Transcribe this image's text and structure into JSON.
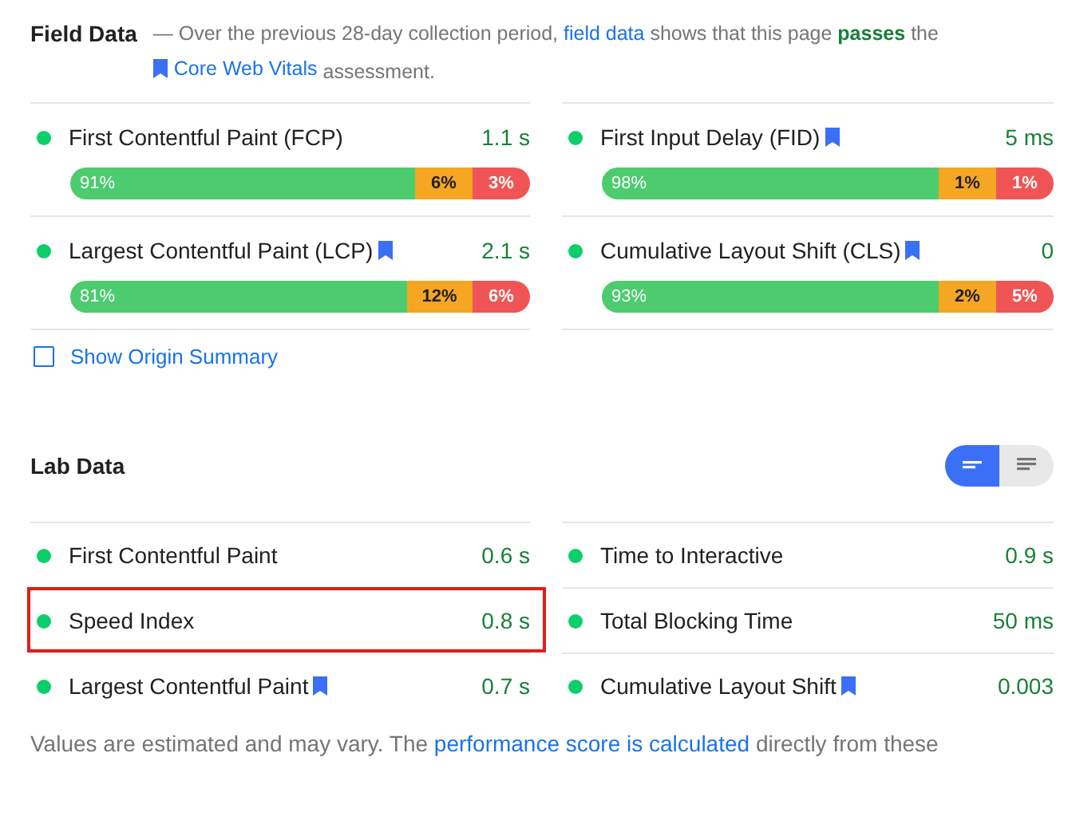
{
  "field_data": {
    "title": "Field Data",
    "description": [
      {
        "kind": "plain",
        "text": "— Over the previous 28-day collection period,"
      },
      {
        "kind": "link",
        "text": "field data"
      },
      {
        "kind": "plain",
        "text": "shows that this page"
      },
      {
        "kind": "pass",
        "text": "passes"
      },
      {
        "kind": "plain",
        "text": "the"
      },
      {
        "kind": "bookmark-link",
        "text": "Core Web Vitals"
      },
      {
        "kind": "plain",
        "text": "assessment."
      }
    ],
    "metrics": [
      {
        "name": "First Contentful Paint (FCP)",
        "bookmark": false,
        "value": "1.1 s",
        "distribution": [
          {
            "label": "91%",
            "kind": "good"
          },
          {
            "label": "6%",
            "kind": "average"
          },
          {
            "label": "3%",
            "kind": "poor"
          }
        ]
      },
      {
        "name": "First Input Delay (FID)",
        "bookmark": true,
        "value": "5 ms",
        "distribution": [
          {
            "label": "98%",
            "kind": "good"
          },
          {
            "label": "1%",
            "kind": "average"
          },
          {
            "label": "1%",
            "kind": "poor"
          }
        ]
      },
      {
        "name": "Largest Contentful Paint (LCP)",
        "bookmark": true,
        "value": "2.1 s",
        "distribution": [
          {
            "label": "81%",
            "kind": "good"
          },
          {
            "label": "12%",
            "kind": "average"
          },
          {
            "label": "6%",
            "kind": "poor"
          }
        ]
      },
      {
        "name": "Cumulative Layout Shift (CLS)",
        "bookmark": true,
        "value": "0",
        "distribution": [
          {
            "label": "93%",
            "kind": "good"
          },
          {
            "label": "2%",
            "kind": "average"
          },
          {
            "label": "5%",
            "kind": "poor"
          }
        ]
      }
    ],
    "origin_summary": {
      "label": "Show Origin Summary",
      "checked": false
    }
  },
  "lab_data": {
    "title": "Lab Data",
    "view_toggle": [
      {
        "kind": "compact",
        "selected": true
      },
      {
        "kind": "expanded",
        "selected": false
      }
    ],
    "metrics": [
      {
        "name": "First Contentful Paint",
        "bookmark": false,
        "value": "0.6 s",
        "highlighted": false
      },
      {
        "name": "Time to Interactive",
        "bookmark": false,
        "value": "0.9 s",
        "highlighted": false
      },
      {
        "name": "Speed Index",
        "bookmark": false,
        "value": "0.8 s",
        "highlighted": true
      },
      {
        "name": "Total Blocking Time",
        "bookmark": false,
        "value": "50 ms",
        "highlighted": false
      },
      {
        "name": "Largest Contentful Paint",
        "bookmark": true,
        "value": "0.7 s",
        "highlighted": false
      },
      {
        "name": "Cumulative Layout Shift",
        "bookmark": true,
        "value": "0.003",
        "highlighted": false
      }
    ],
    "footnote": [
      {
        "kind": "plain",
        "text": "Values are estimated and may vary. The"
      },
      {
        "kind": "link",
        "text": "performance score is calculated"
      },
      {
        "kind": "plain",
        "text": "directly from these"
      }
    ]
  }
}
